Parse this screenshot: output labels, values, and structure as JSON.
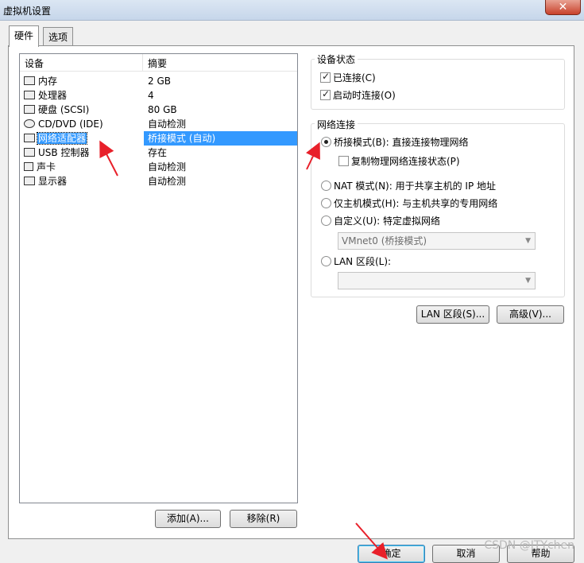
{
  "window": {
    "title": "虚拟机设置",
    "close_label": "✕"
  },
  "tabs": [
    {
      "label": "硬件",
      "active": true
    },
    {
      "label": "选项",
      "active": false
    }
  ],
  "device_list": {
    "header_device": "设备",
    "header_summary": "摘要",
    "rows": [
      {
        "icon": "memory-icon",
        "device": "内存",
        "summary": "2 GB"
      },
      {
        "icon": "processor-icon",
        "device": "处理器",
        "summary": "4"
      },
      {
        "icon": "harddisk-icon",
        "device": "硬盘 (SCSI)",
        "summary": "80 GB"
      },
      {
        "icon": "cd-dvd-icon",
        "device": "CD/DVD (IDE)",
        "summary": "自动检测"
      },
      {
        "icon": "network-adapter-icon",
        "device": "网络适配器",
        "summary": "桥接模式 (自动)",
        "selected": true
      },
      {
        "icon": "usb-controller-icon",
        "device": "USB 控制器",
        "summary": "存在"
      },
      {
        "icon": "sound-card-icon",
        "device": "声卡",
        "summary": "自动检测"
      },
      {
        "icon": "display-icon",
        "device": "显示器",
        "summary": "自动检测"
      }
    ],
    "add_button": "添加(A)...",
    "remove_button": "移除(R)"
  },
  "device_status": {
    "title": "设备状态",
    "connected": {
      "label": "已连接(C)",
      "checked": true
    },
    "connect_at_power_on": {
      "label": "启动时连接(O)",
      "checked": true
    }
  },
  "network": {
    "title": "网络连接",
    "bridged": {
      "label": "桥接模式(B): 直接连接物理网络",
      "selected": true
    },
    "replicate": {
      "label": "复制物理网络连接状态(P)",
      "checked": false
    },
    "nat": {
      "label": "NAT 模式(N): 用于共享主机的 IP 地址",
      "selected": false
    },
    "host_only": {
      "label": "仅主机模式(H): 与主机共享的专用网络",
      "selected": false
    },
    "custom": {
      "label": "自定义(U): 特定虚拟网络",
      "selected": false
    },
    "custom_select_value": "VMnet0 (桥接模式)",
    "lan_segment": {
      "label": "LAN 区段(L):",
      "selected": false
    },
    "lan_select_value": ""
  },
  "buttons": {
    "lan_segments": "LAN 区段(S)...",
    "advanced": "高级(V)...",
    "ok": "确定",
    "cancel": "取消",
    "help": "帮助"
  },
  "watermark": "CSDN @ITYchen",
  "colors": {
    "selection": "#3399ff",
    "annotation_arrow": "#e8202a"
  }
}
